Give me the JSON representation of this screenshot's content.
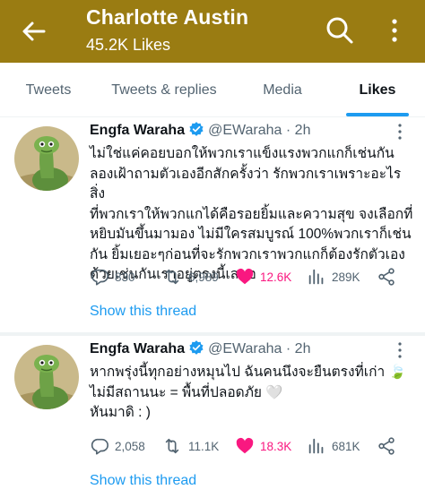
{
  "header": {
    "title": "Charlotte Austin",
    "subtitle": "45.2K Likes",
    "icons": {
      "back": "arrow-left-icon",
      "search": "search-icon",
      "more": "more-vertical-icon"
    },
    "color": "#9a7c12"
  },
  "tabs": [
    {
      "label": "Tweets",
      "active": false
    },
    {
      "label": "Tweets & replies",
      "active": false
    },
    {
      "label": "Media",
      "active": false
    },
    {
      "label": "Likes",
      "active": true
    }
  ],
  "accent_color": "#1d9bf0",
  "like_color": "#f91880",
  "tweets": [
    {
      "name": "Engfa Waraha",
      "verified": true,
      "handle": "@EWaraha",
      "separator": "·",
      "time": "2h",
      "text": "ไม่ใช่แค่คอยบอกให้พวกเราแข็งแรงพวกแกก็เช่นกัน\nลองเฝ้าถามตัวเองอีกสักครั้งว่า รักพวกเราเพราะอะไร สิ่ง\nที่พวกเราให้พวกแกได้คือรอยยิ้มและความสุข จงเลือกที่\nหยิบมันขึ้นมามอง ไม่มีใครสมบูรณ์ 100%พวกเราก็เช่น\nกัน ยิ้มเยอะๆก่อนที่จะรักพวกเราพวกแกก็ต้องรักตัวเอง\nด้วยเช่นกันเราอยู่ตรงนี้เสมอ",
      "replies": "830",
      "retweets": "6,989",
      "likes": "12.6K",
      "views": "289K",
      "liked": true,
      "show_thread": "Show this thread"
    },
    {
      "name": "Engfa Waraha",
      "verified": true,
      "handle": "@EWaraha",
      "separator": "·",
      "time": "2h",
      "text": "หากพรุ่งนี้ทุกอย่างหมุนไป ฉันคนนึงจะยืนตรงที่เก่า 🍃\nไม่มีสถานนะ = พื้นที่ปลอดภัย 🤍\nหันมาดิ : )",
      "replies": "2,058",
      "retweets": "11.1K",
      "likes": "18.3K",
      "views": "681K",
      "liked": true,
      "show_thread": "Show this thread"
    }
  ]
}
